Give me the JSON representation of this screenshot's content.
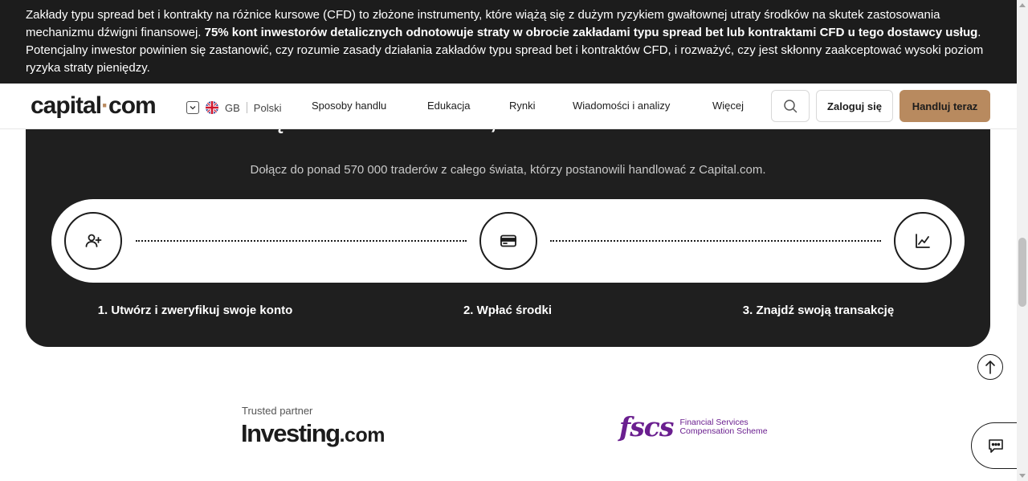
{
  "risk_banner": {
    "text_start": "Zakłady typu spread bet i kontrakty na różnice kursowe (CFD) to złożone instrumenty, które wiążą się z dużym ryzykiem gwałtownej utraty środków na skutek zastosowania mechanizmu dźwigni finansowej. ",
    "text_bold": "75% kont inwestorów detalicznych odnotowuje straty w obrocie zakładami typu spread bet lub kontraktami CFD u tego dostawcy usług",
    "text_end": ". Potencjalny inwestor powinien się zastanowić, czy rozumie zasady działania zakładów typu spread bet i kontraktów CFD, i rozważyć, czy jest skłonny zaakceptować wysoki poziom ryzyka straty pieniędzy."
  },
  "header": {
    "logo_left": "capital",
    "logo_dot": "·",
    "logo_right": "com",
    "region": "GB",
    "language": "Polski",
    "nav": [
      "Sposoby handlu",
      "Edukacja",
      "Rynki",
      "Wiadomości i analizy",
      "Więcej"
    ],
    "login_label": "Zaloguj się",
    "trade_label": "Handluj teraz"
  },
  "card": {
    "title": "Wciąż szukasz brokera, któremu możesz zaufać?",
    "subtitle": "Dołącz do ponad 570 000 traderów z całego świata, którzy postanowili handlować z Capital.com.",
    "steps": [
      {
        "label": "1. Utwórz i zweryfikuj swoje konto",
        "icon": "add-user-icon"
      },
      {
        "label": "2. Wpłać środki",
        "icon": "credit-card-icon"
      },
      {
        "label": "3. Znajdź swoją transakcję",
        "icon": "chart-line-icon"
      }
    ]
  },
  "partners": {
    "trusted_label": "Trusted partner",
    "investing_name": "Investing",
    "investing_suffix": ".com",
    "fscs_mark": "fscs",
    "fscs_line1": "Financial Services",
    "fscs_line2": "Compensation Scheme"
  },
  "colors": {
    "banner_bg": "#1c1c1c",
    "accent": "#b88a5f",
    "card_bg": "#1f1f1f",
    "fscs_purple": "#6a1f8f"
  }
}
